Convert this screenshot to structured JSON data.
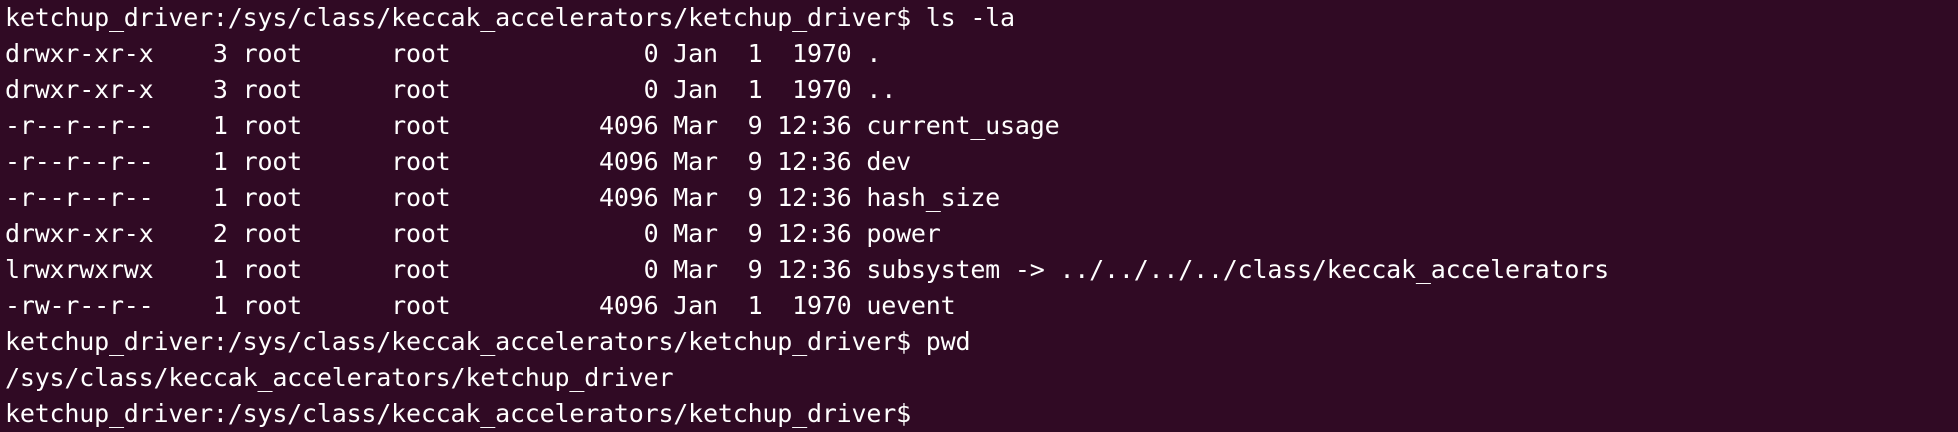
{
  "terminal": {
    "lines": [
      "ketchup_driver:/sys/class/keccak_accelerators/ketchup_driver$ ls -la",
      "drwxr-xr-x    3 root      root             0 Jan  1  1970 .",
      "drwxr-xr-x    3 root      root             0 Jan  1  1970 ..",
      "-r--r--r--    1 root      root          4096 Mar  9 12:36 current_usage",
      "-r--r--r--    1 root      root          4096 Mar  9 12:36 dev",
      "-r--r--r--    1 root      root          4096 Mar  9 12:36 hash_size",
      "drwxr-xr-x    2 root      root             0 Mar  9 12:36 power",
      "lrwxrwxrwx    1 root      root             0 Mar  9 12:36 subsystem -> ../../../../class/keccak_accelerators",
      "-rw-r--r--    1 root      root          4096 Jan  1  1970 uevent",
      "ketchup_driver:/sys/class/keccak_accelerators/ketchup_driver$ pwd",
      "/sys/class/keccak_accelerators/ketchup_driver",
      "ketchup_driver:/sys/class/keccak_accelerators/ketchup_driver$"
    ]
  }
}
